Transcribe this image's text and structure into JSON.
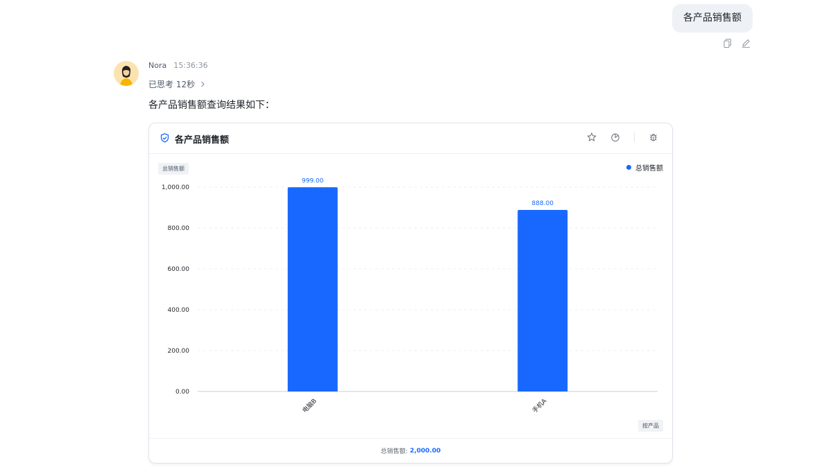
{
  "user_message": "各产品销售额",
  "assistant": {
    "name": "Nora",
    "time": "15:36:36",
    "thinking_label": "已思考 12秒",
    "answer_text": "各产品销售额查询结果如下："
  },
  "card": {
    "title": "各产品销售额",
    "y_tag": "总销售额",
    "x_tag": "按产品",
    "legend_label": "总销售额",
    "footer_label": "总销售额:",
    "footer_value": "2,000.00"
  },
  "colors": {
    "accent": "#1868ff",
    "bubble": "#eef1f6"
  },
  "chart_data": {
    "type": "bar",
    "categories": [
      "电脑B",
      "手机A"
    ],
    "series": [
      {
        "name": "总销售额",
        "values": [
          999,
          888
        ]
      }
    ],
    "data_labels": [
      "999.00",
      "888.00"
    ],
    "y_ticks": [
      "0.00",
      "200.00",
      "400.00",
      "600.00",
      "800.00",
      "1,000.00"
    ],
    "ylim": [
      0,
      1000
    ],
    "ylabel": "总销售额",
    "xlabel": "按产品",
    "grid": true,
    "legend": "top-right"
  }
}
